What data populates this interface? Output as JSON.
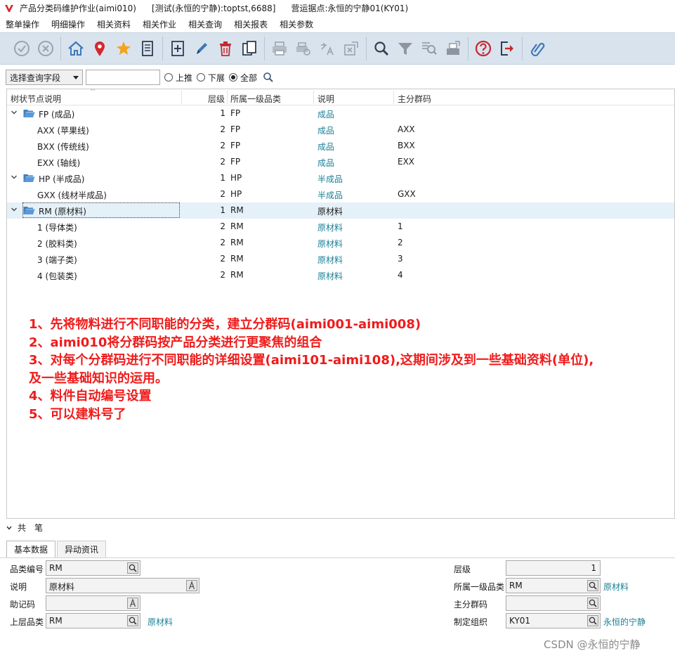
{
  "window": {
    "title": "产品分类码维护作业(aimi010)",
    "connection": "[测试(永恒的宁静):toptst,6688]",
    "site": "营运据点:永恒的宁静01(KY01)"
  },
  "menu": [
    "整单操作",
    "明细操作",
    "相关资料",
    "相关作业",
    "相关查询",
    "相关报表",
    "相关参数"
  ],
  "toolbar_icons": [
    "check-circle-icon",
    "cancel-circle-icon",
    "home-icon",
    "location-pin-icon",
    "star-icon",
    "list-icon",
    "add-document-icon",
    "edit-pencil-icon",
    "delete-trash-icon",
    "copy-icon",
    "print-icon",
    "print-preview-icon",
    "translate-icon",
    "export-icon",
    "search-icon",
    "filter-icon",
    "advanced-filter-icon",
    "folder-tray-icon",
    "help-icon",
    "exit-icon",
    "attachment-icon"
  ],
  "colors": {
    "accent_link": "#1a7f96",
    "note_red": "#ef1b1b",
    "toolbar_bg": "#d9e3ee",
    "selected_row": "#e5f1f8",
    "folder_blue": "#3f7fc5"
  },
  "filter": {
    "field_select": "选择查询字段",
    "query_value": "",
    "radios": [
      {
        "label": "上推",
        "checked": false
      },
      {
        "label": "下展",
        "checked": false
      },
      {
        "label": "全部",
        "checked": true
      }
    ]
  },
  "tree": {
    "headers": [
      "树状节点说明",
      "层级",
      "所属一级品类",
      "说明",
      "主分群码"
    ],
    "rows": [
      {
        "label": "FP (成品)",
        "level": "1",
        "category": "FP",
        "desc": "成品",
        "group": "",
        "group_node": true,
        "selected": false
      },
      {
        "label": "AXX (苹果线)",
        "level": "2",
        "category": "FP",
        "desc": "成品",
        "group": "AXX",
        "group_node": false,
        "selected": false
      },
      {
        "label": "BXX (传统线)",
        "level": "2",
        "category": "FP",
        "desc": "成品",
        "group": "BXX",
        "group_node": false,
        "selected": false
      },
      {
        "label": "EXX (轴线)",
        "level": "2",
        "category": "FP",
        "desc": "成品",
        "group": "EXX",
        "group_node": false,
        "selected": false
      },
      {
        "label": "HP (半成品)",
        "level": "1",
        "category": "HP",
        "desc": "半成品",
        "group": "",
        "group_node": true,
        "selected": false
      },
      {
        "label": "GXX (线材半成品)",
        "level": "2",
        "category": "HP",
        "desc": "半成品",
        "group": "GXX",
        "group_node": false,
        "selected": false
      },
      {
        "label": "RM (原材料)",
        "level": "1",
        "category": "RM",
        "desc": "原材料",
        "group": "",
        "group_node": true,
        "selected": true
      },
      {
        "label": "1 (导体类)",
        "level": "2",
        "category": "RM",
        "desc": "原材料",
        "group": "1",
        "group_node": false,
        "selected": false
      },
      {
        "label": "2 (胶料类)",
        "level": "2",
        "category": "RM",
        "desc": "原材料",
        "group": "2",
        "group_node": false,
        "selected": false
      },
      {
        "label": "3 (端子类)",
        "level": "2",
        "category": "RM",
        "desc": "原材料",
        "group": "3",
        "group_node": false,
        "selected": false
      },
      {
        "label": "4 (包装类)",
        "level": "2",
        "category": "RM",
        "desc": "原材料",
        "group": "4",
        "group_node": false,
        "selected": false
      }
    ]
  },
  "notes": [
    "1、先将物料进行不同职能的分类，建立分群码(aimi001-aimi008)",
    "2、aimi010将分群码按产品分类进行更聚焦的组合",
    "3、对每个分群码进行不同职能的详细设置(aimi101-aimi108),这期间涉及到一些基础资料(单位),",
    "及一些基础知识的运用。",
    "4、料件自动编号设置",
    "5、可以建料号了"
  ],
  "detail": {
    "section_title": "共　笔",
    "tabs": [
      "基本数据",
      "异动资讯"
    ],
    "fields": {
      "category_code": {
        "label": "品类编号",
        "value": "RM"
      },
      "description": {
        "label": "说明",
        "value": "原材料"
      },
      "mnemonic": {
        "label": "助记码",
        "value": ""
      },
      "parent_category": {
        "label": "上层品类",
        "value": "RM",
        "desc": "原材料"
      },
      "level": {
        "label": "层级",
        "value": "1"
      },
      "top_category": {
        "label": "所属一级品类",
        "value": "RM",
        "desc": "原材料"
      },
      "main_group": {
        "label": "主分群码",
        "value": ""
      },
      "org": {
        "label": "制定组织",
        "value": "KY01",
        "desc": "永恒的宁静"
      }
    }
  },
  "watermark": "CSDN @永恒的宁静"
}
